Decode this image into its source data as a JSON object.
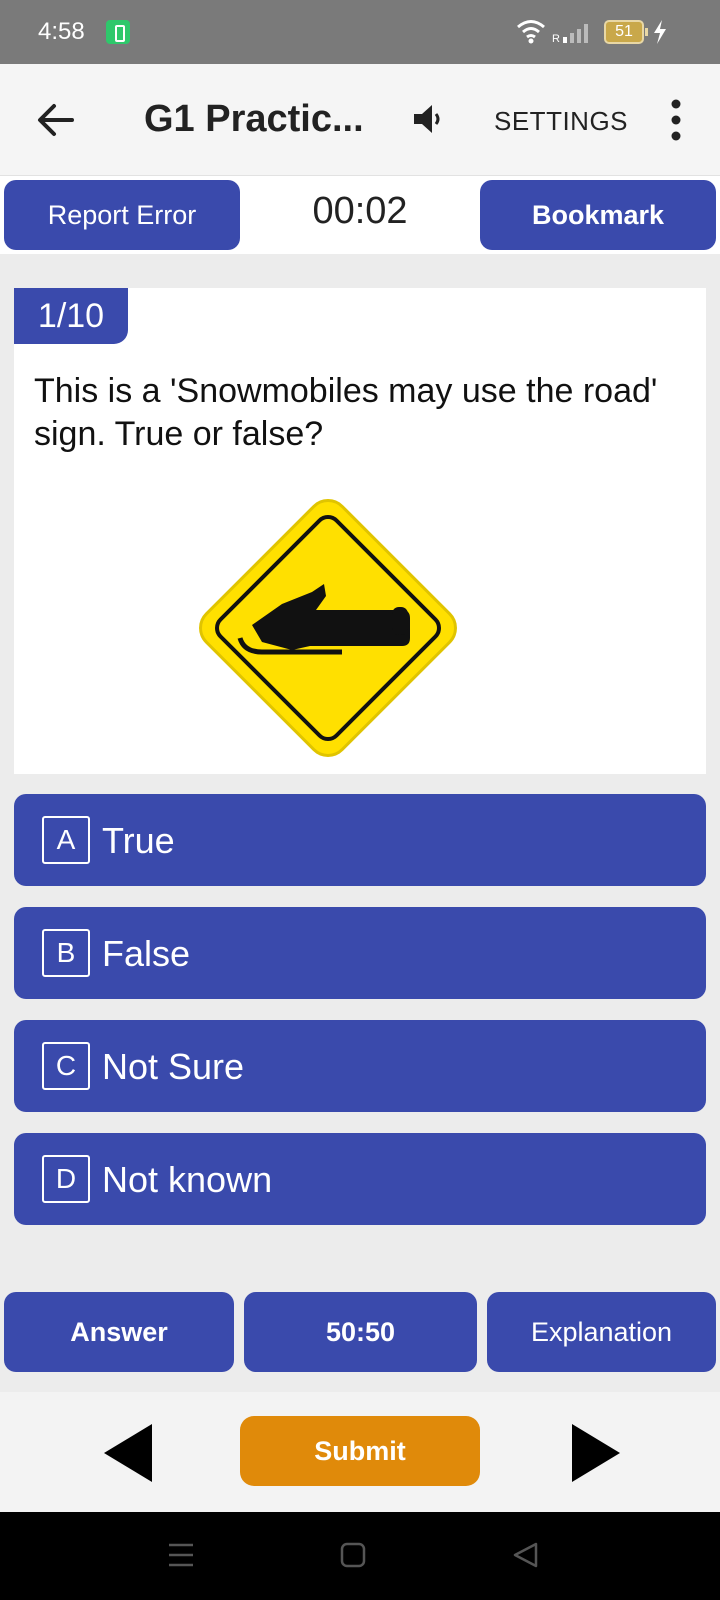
{
  "status_bar": {
    "time": "4:58",
    "battery_level": "51"
  },
  "app_bar": {
    "title": "G1 Practic...",
    "settings_label": "SETTINGS"
  },
  "top_row": {
    "report_label": "Report Error",
    "timer": "00:02",
    "bookmark_label": "Bookmark"
  },
  "question": {
    "number": "1/10",
    "text": "This is a 'Snowmobiles may use the road' sign. True or false?",
    "sign_colors": {
      "fill": "#ffe000",
      "border": "#111111"
    }
  },
  "options": [
    {
      "letter": "A",
      "text": "True"
    },
    {
      "letter": "B",
      "text": "False"
    },
    {
      "letter": "C",
      "text": "Not Sure"
    },
    {
      "letter": "D",
      "text": "Not known"
    }
  ],
  "helpers": {
    "answer_label": "Answer",
    "fifty_label": "50:50",
    "explanation_label": "Explanation"
  },
  "navigation": {
    "submit_label": "Submit"
  },
  "colors": {
    "primary": "#3a4aac",
    "submit": "#e08a0a",
    "status_bar": "#7a7a7a"
  }
}
